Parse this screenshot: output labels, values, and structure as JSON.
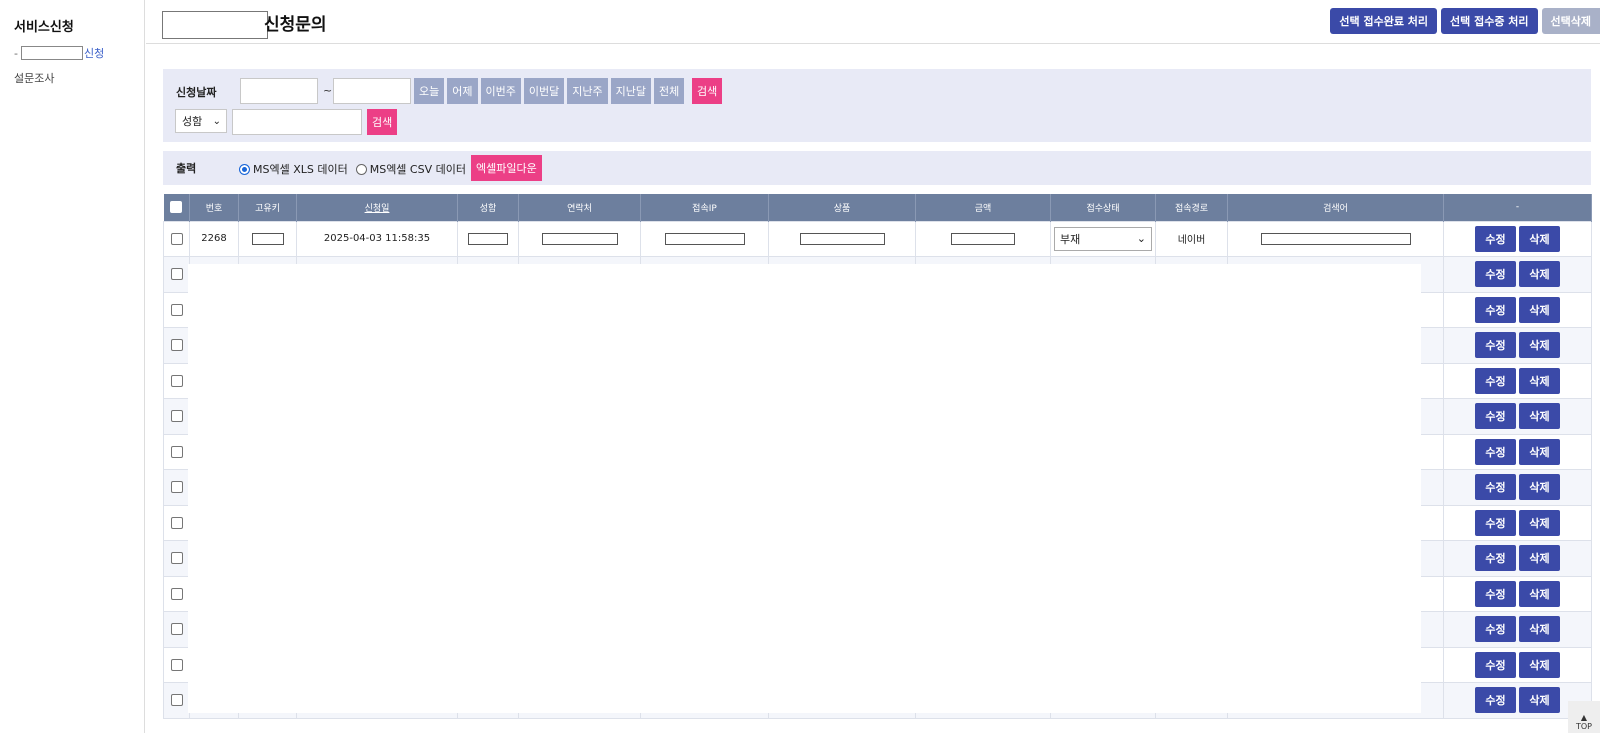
{
  "sidebar": {
    "title": "서비스신청",
    "link_suffix": "신청",
    "survey": "설문조사"
  },
  "header": {
    "title": "신청문의",
    "buttons": {
      "complete": "선택 접수완료 처리",
      "inprogress": "선택 접수중 처리",
      "delete": "선택삭제"
    }
  },
  "search": {
    "date_label": "신청날짜",
    "tilde": "~",
    "quick": [
      "오늘",
      "어제",
      "이번주",
      "이번달",
      "지난주",
      "지난달",
      "전체"
    ],
    "search_btn": "검색",
    "field_select": "성함",
    "search_btn2": "검색"
  },
  "output": {
    "label": "출력",
    "opt_xls": "MS엑셀 XLS 데이터",
    "opt_csv": "MS엑셀 CSV 데이터",
    "download": "엑셀파일다운"
  },
  "table": {
    "headers": {
      "no": "번호",
      "key": "고유키",
      "date": "신청일",
      "name": "성함",
      "phone": "연락처",
      "ip": "접속IP",
      "product": "상품",
      "amount": "금액",
      "status": "접수상태",
      "route": "접속경로",
      "keyword": "검색어",
      "dash": "-"
    },
    "first_row": {
      "no": "2268",
      "date": "2025-04-03 11:58:35",
      "status": "부재",
      "route": "네이버"
    },
    "edit_label": "수정",
    "delete_label": "삭제"
  },
  "top_button": "TOP"
}
